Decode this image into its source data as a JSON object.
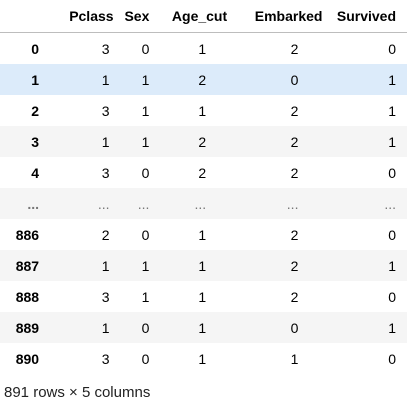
{
  "table": {
    "columns": [
      "Pclass",
      "Sex",
      "Age_cut",
      "Embarked",
      "Survived"
    ],
    "rows": [
      {
        "index": "0",
        "values": [
          "3",
          "0",
          "1",
          "2",
          "0"
        ]
      },
      {
        "index": "1",
        "values": [
          "1",
          "1",
          "2",
          "0",
          "1"
        ]
      },
      {
        "index": "2",
        "values": [
          "3",
          "1",
          "1",
          "2",
          "1"
        ]
      },
      {
        "index": "3",
        "values": [
          "1",
          "1",
          "2",
          "2",
          "1"
        ]
      },
      {
        "index": "4",
        "values": [
          "3",
          "0",
          "2",
          "2",
          "0"
        ]
      },
      {
        "index": "...",
        "values": [
          "...",
          "...",
          "...",
          "...",
          "..."
        ]
      },
      {
        "index": "886",
        "values": [
          "2",
          "0",
          "1",
          "2",
          "0"
        ]
      },
      {
        "index": "887",
        "values": [
          "1",
          "1",
          "1",
          "2",
          "1"
        ]
      },
      {
        "index": "888",
        "values": [
          "3",
          "1",
          "1",
          "2",
          "0"
        ]
      },
      {
        "index": "889",
        "values": [
          "1",
          "0",
          "1",
          "0",
          "1"
        ]
      },
      {
        "index": "890",
        "values": [
          "3",
          "0",
          "1",
          "1",
          "0"
        ]
      }
    ],
    "selected_row_index": "1",
    "highlight_color": "#dcebfa",
    "stripe_color": "#f5f5f5"
  },
  "footer": {
    "shape_text": "891 rows × 5 columns"
  }
}
